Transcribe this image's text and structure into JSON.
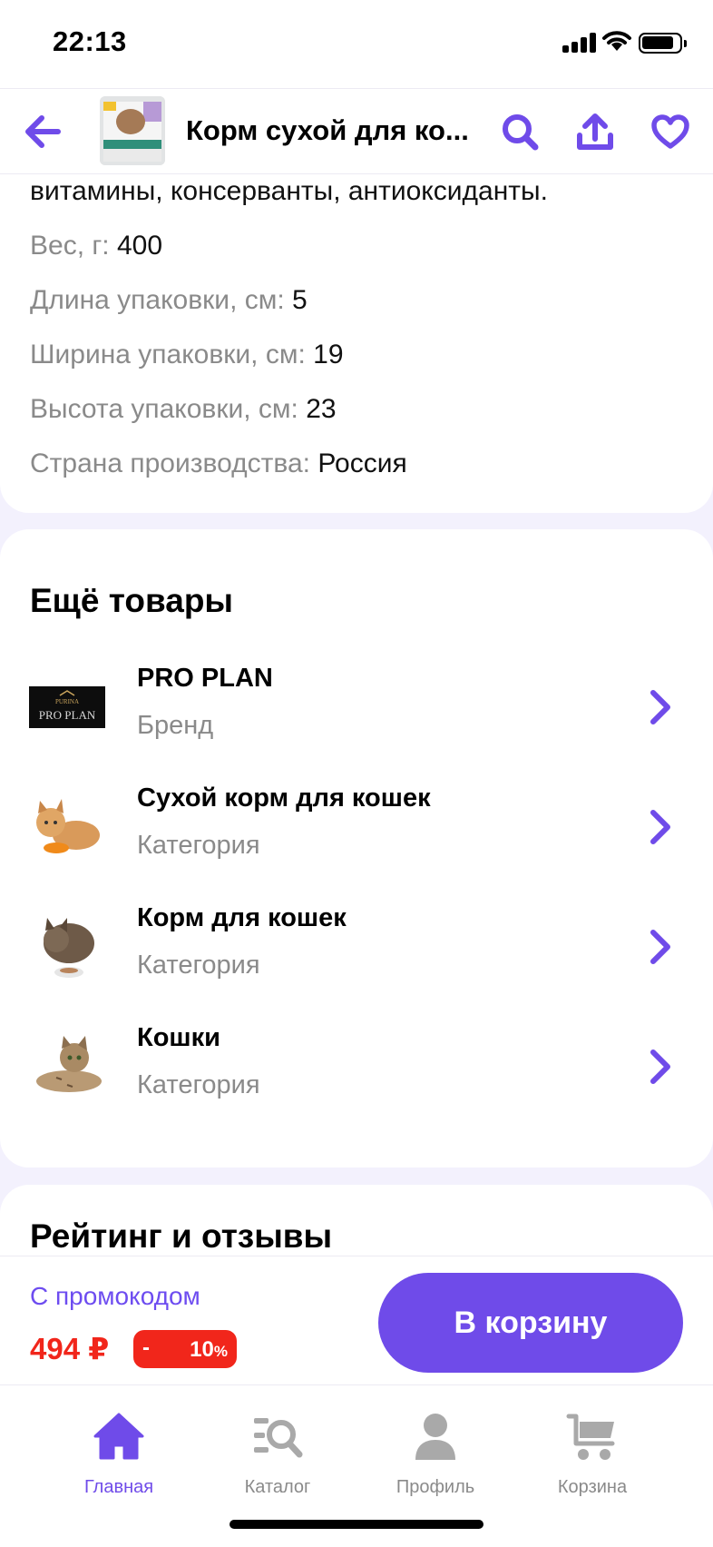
{
  "status_bar": {
    "time": "22:13"
  },
  "header": {
    "title": "Корм сухой для ко...",
    "icons": {
      "back": "arrow-left-icon",
      "search": "search-icon",
      "share": "share-icon",
      "favorite": "heart-icon"
    }
  },
  "specs": {
    "intro": "витамины, консерванты, антиоксиданты.",
    "rows": [
      {
        "key": "Вес, г:",
        "value": "400"
      },
      {
        "key": "Длина упаковки, см:",
        "value": "5"
      },
      {
        "key": "Ширина упаковки, см:",
        "value": "19"
      },
      {
        "key": "Высота упаковки, см:",
        "value": "23"
      },
      {
        "key": "Страна производства:",
        "value": "Россия"
      }
    ]
  },
  "more_goods": {
    "title": "Ещё товары",
    "items": [
      {
        "title": "PRO PLAN",
        "subtitle": "Бренд",
        "logo_text_top": "PURINA",
        "logo_text": "PRO PLAN"
      },
      {
        "title": "Сухой корм для кошек",
        "subtitle": "Категория"
      },
      {
        "title": "Корм для кошек",
        "subtitle": "Категория"
      },
      {
        "title": "Кошки",
        "subtitle": "Категория"
      }
    ]
  },
  "reviews": {
    "title": "Рейтинг и отзывы"
  },
  "buy_bar": {
    "promo_label": "С промокодом",
    "price": "494 ₽",
    "discount_minus": "-",
    "discount_value": "10",
    "discount_sign": "%",
    "add_to_cart": "В корзину"
  },
  "tabbar": {
    "items": [
      {
        "label": "Главная",
        "icon": "home-icon",
        "active": true
      },
      {
        "label": "Каталог",
        "icon": "catalog-search-icon",
        "active": false
      },
      {
        "label": "Профиль",
        "icon": "profile-icon",
        "active": false
      },
      {
        "label": "Корзина",
        "icon": "cart-icon",
        "active": false
      }
    ]
  },
  "colors": {
    "accent": "#6f4be9",
    "price": "#f1261b",
    "muted": "#8a8a8a",
    "background": "#f3f1fd"
  }
}
